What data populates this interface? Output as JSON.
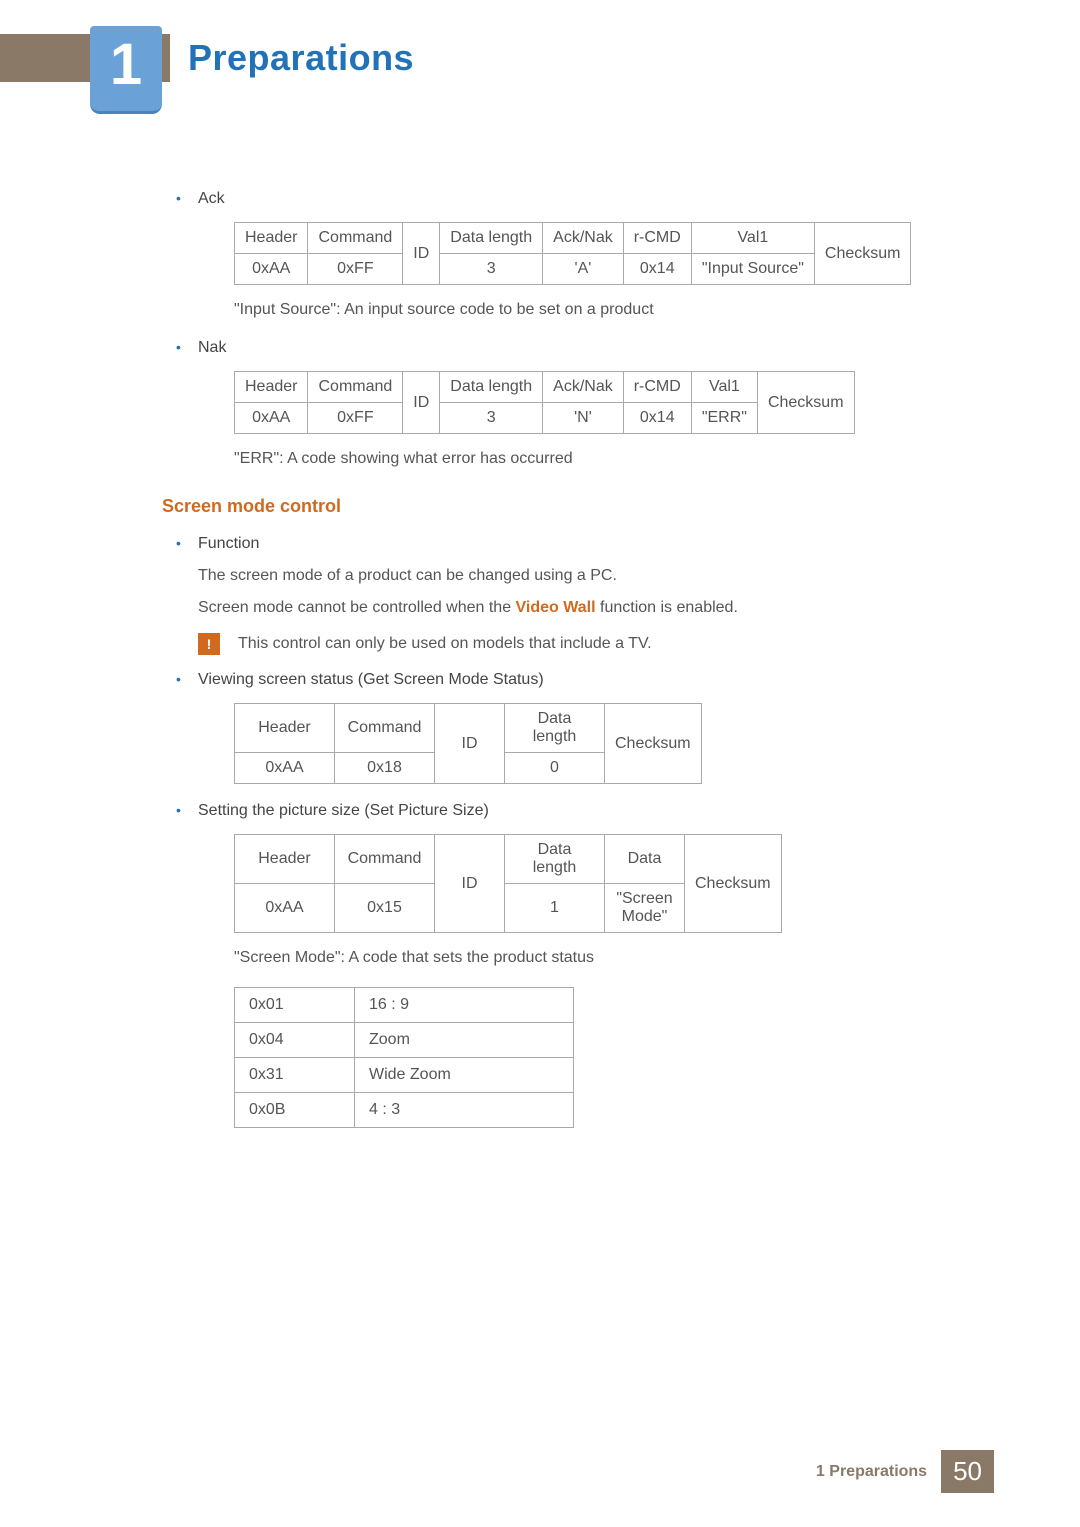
{
  "chapter": {
    "number": "1",
    "title": "Preparations"
  },
  "footer": {
    "label": "1 Preparations",
    "page": "50"
  },
  "labels": {
    "ack": "Ack",
    "nak": "Nak",
    "function": "Function",
    "viewing": "Viewing screen status (Get Screen Mode Status)",
    "setting": "Setting the picture size (Set Picture Size)"
  },
  "ack_table": {
    "h": [
      "Header",
      "Command",
      "ID",
      "Data length",
      "Ack/Nak",
      "r-CMD",
      "Val1",
      "Checksum"
    ],
    "v": [
      "0xAA",
      "0xFF",
      "3",
      "'A'",
      "0x14",
      "\"Input Source\""
    ]
  },
  "ack_note": "\"Input Source\": An input source code to be set on a product",
  "nak_table": {
    "h": [
      "Header",
      "Command",
      "ID",
      "Data length",
      "Ack/Nak",
      "r-CMD",
      "Val1",
      "Checksum"
    ],
    "v": [
      "0xAA",
      "0xFF",
      "3",
      "'N'",
      "0x14",
      "\"ERR\""
    ]
  },
  "nak_note": "\"ERR\": A code showing what error has occurred",
  "section2": {
    "title": "Screen mode control",
    "func_line1": "The screen mode of a product can be changed using a PC.",
    "func_line2_a": "Screen mode cannot be controlled when the ",
    "func_line2_b": "Video Wall",
    "func_line2_c": " function is enabled.",
    "info": "This control can only be used on models that include a TV."
  },
  "get_table": {
    "h": [
      "Header",
      "Command",
      "ID",
      "Data length",
      "Checksum"
    ],
    "v": [
      "0xAA",
      "0x18",
      "0"
    ]
  },
  "set_table": {
    "h": [
      "Header",
      "Command",
      "ID",
      "Data length",
      "Data",
      "Checksum"
    ],
    "v": [
      "0xAA",
      "0x15",
      "1",
      "\"Screen Mode\""
    ]
  },
  "set_note": "\"Screen Mode\": A code that sets the product status",
  "modes": [
    {
      "code": "0x01",
      "label": "16 : 9"
    },
    {
      "code": "0x04",
      "label": "Zoom"
    },
    {
      "code": "0x31",
      "label": "Wide Zoom"
    },
    {
      "code": "0x0B",
      "label": "4 : 3"
    }
  ]
}
